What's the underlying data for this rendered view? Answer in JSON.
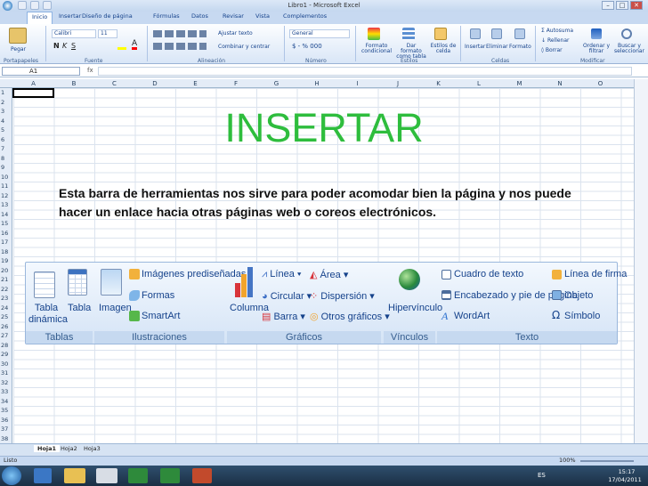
{
  "window": {
    "title": "Libro1 - Microsoft Excel",
    "min": "–",
    "max": "□",
    "close": "✕"
  },
  "tabs": [
    "Inicio",
    "Insertar",
    "Diseño de página",
    "Fórmulas",
    "Datos",
    "Revisar",
    "Vista",
    "Complementos"
  ],
  "ribbon": {
    "paste_label": "Pegar",
    "font_name": "Calibri",
    "font_size": "11",
    "wrap_text": "Ajustar texto",
    "merge": "Combinar y centrar",
    "number_format": "General",
    "number_symbols": "$ - % 000",
    "cond_format": "Formato condicional",
    "table_format": "Dar formato como tabla",
    "cell_styles": "Estilos de celda",
    "insert": "Insertar",
    "delete": "Eliminar",
    "format": "Formato",
    "autosum": "Autosuma",
    "fill": "Rellenar",
    "clear": "Borrar",
    "sort": "Ordenar y filtrar",
    "find": "Buscar y seleccionar",
    "groups": [
      "Portapapeles",
      "Fuente",
      "Alineación",
      "Número",
      "Estilos",
      "Celdas",
      "Modificar"
    ]
  },
  "formula_bar": {
    "name_box": "A1",
    "fx": "fx",
    "value": ""
  },
  "columns": [
    "A",
    "B",
    "C",
    "D",
    "E",
    "F",
    "G",
    "H",
    "I",
    "J",
    "K",
    "L",
    "M",
    "N",
    "O"
  ],
  "rows": [
    "1",
    "2",
    "3",
    "4",
    "5",
    "6",
    "7",
    "8",
    "9",
    "10",
    "11",
    "12",
    "13",
    "14",
    "15",
    "16",
    "17",
    "18",
    "19",
    "20",
    "21",
    "22",
    "23",
    "24",
    "25",
    "26",
    "27",
    "28",
    "29",
    "30",
    "31",
    "32",
    "33",
    "34",
    "35",
    "36",
    "37",
    "38"
  ],
  "overlay": {
    "heading": "INSERTAR",
    "description": "Esta barra de herramientas nos sirve para poder acomodar bien la página y nos puede hacer un enlace hacia otras páginas web o coreos electrónicos."
  },
  "insert_ribbon": {
    "tablas": {
      "dynamic_table": "Tabla dinámica",
      "table": "Tabla",
      "label": "Tablas"
    },
    "ilustraciones": {
      "image": "Imagen",
      "clipart": "Imágenes prediseñadas",
      "shapes": "Formas",
      "smartart": "SmartArt",
      "label": "Ilustraciones"
    },
    "graficos": {
      "column": "Columna",
      "line": "Línea",
      "pie": "Circular",
      "bar": "Barra",
      "area": "Área",
      "scatter": "Dispersión",
      "other": "Otros gráficos",
      "label": "Gráficos"
    },
    "vinculos": {
      "hyperlink": "Hipervínculo",
      "label": "Vínculos"
    },
    "texto": {
      "textbox": "Cuadro de texto",
      "header_footer": "Encabezado y pie de página",
      "wordart": "WordArt",
      "signature": "Línea de firma",
      "object": "Objeto",
      "symbol": "Símbolo",
      "label": "Texto"
    }
  },
  "sheets": [
    "Hoja1",
    "Hoja2",
    "Hoja3"
  ],
  "status": {
    "ready": "Listo",
    "zoom": "100%"
  },
  "taskbar": {
    "lang": "ES",
    "time": "15:17",
    "date": "17/04/2011"
  }
}
